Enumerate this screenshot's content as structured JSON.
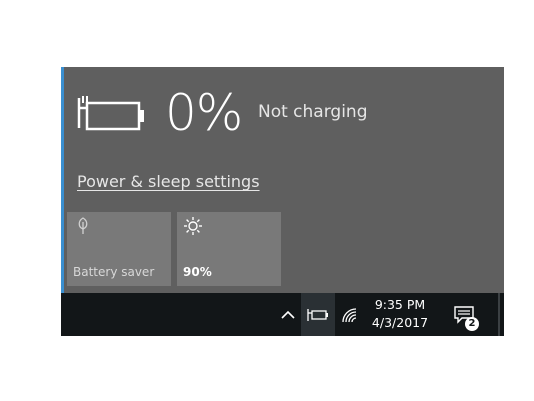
{
  "battery": {
    "percent": "0%",
    "status": "Not charging",
    "icon": "battery-plugged-icon"
  },
  "links": {
    "power_sleep_settings": "Power & sleep settings"
  },
  "quick_actions": [
    {
      "label": "Battery saver",
      "icon": "leaf-icon",
      "active": false
    },
    {
      "label": "90%",
      "icon": "sun-icon",
      "active": true
    }
  ],
  "taskbar": {
    "time": "9:35 PM",
    "date": "4/3/2017",
    "notification_count": "2",
    "icons": [
      "chevron-up-icon",
      "battery-plugged-icon",
      "wifi-icon",
      "action-center-icon"
    ]
  },
  "colors": {
    "flyout_bg": "#5f5f5f",
    "tile_bg": "#797979",
    "taskbar_bg": "#121618",
    "accent": "#3a8fd0"
  }
}
